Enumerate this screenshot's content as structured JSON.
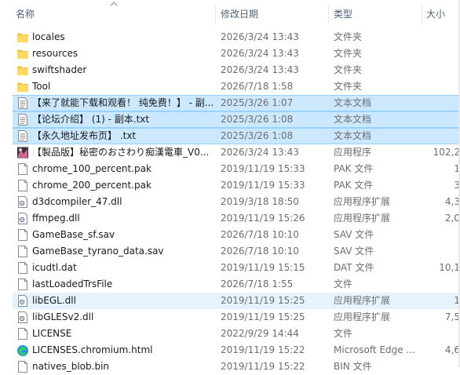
{
  "header": {
    "name": "名称",
    "date": "修改日期",
    "type": "类型",
    "size": "大小"
  },
  "files": [
    {
      "name": "locales",
      "date": "2026/3/24 13:43",
      "type": "文件夹",
      "size": "",
      "icon": "folder-icon"
    },
    {
      "name": "resources",
      "date": "2026/3/24 13:43",
      "type": "文件夹",
      "size": "",
      "icon": "folder-icon"
    },
    {
      "name": "swiftshader",
      "date": "2026/3/24 13:43",
      "type": "文件夹",
      "size": "",
      "icon": "folder-icon"
    },
    {
      "name": "Tool",
      "date": "2026/7/18 1:58",
      "type": "文件夹",
      "size": "",
      "icon": "folder-icon"
    },
    {
      "name": "【来了就能下载和观看！ 纯免费！】 - 副...",
      "date": "2025/3/26 1:07",
      "type": "文本文档",
      "size": "",
      "icon": "text-file-icon",
      "selected": true
    },
    {
      "name": "【论坛介绍】 (1) - 副本.txt",
      "date": "2025/3/26 1:08",
      "type": "文本文档",
      "size": "",
      "icon": "text-file-icon",
      "selected": true
    },
    {
      "name": "【永久地址发布页】 .txt",
      "date": "2025/3/26 1:08",
      "type": "文本文档",
      "size": "",
      "icon": "text-file-icon",
      "selected": true
    },
    {
      "name": "【製品版】秘密のおさわり痴漢電車_V0...",
      "date": "2026/3/24 13:43",
      "type": "应用程序",
      "size": "102,2",
      "icon": "app-icon"
    },
    {
      "name": "chrome_100_percent.pak",
      "date": "2019/11/19 15:33",
      "type": "PAK 文件",
      "size": "1",
      "icon": "file-icon"
    },
    {
      "name": "chrome_200_percent.pak",
      "date": "2019/11/19 15:33",
      "type": "PAK 文件",
      "size": "3",
      "icon": "file-icon"
    },
    {
      "name": "d3dcompiler_47.dll",
      "date": "2019/3/18 18:50",
      "type": "应用程序扩展",
      "size": "4,3",
      "icon": "dll-icon"
    },
    {
      "name": "ffmpeg.dll",
      "date": "2019/11/19 15:26",
      "type": "应用程序扩展",
      "size": "2,0",
      "icon": "dll-icon"
    },
    {
      "name": "GameBase_sf.sav",
      "date": "2026/7/18 10:10",
      "type": "SAV 文件",
      "size": "",
      "icon": "file-icon"
    },
    {
      "name": "GameBase_tyrano_data.sav",
      "date": "2026/7/18 10:10",
      "type": "SAV 文件",
      "size": "",
      "icon": "file-icon"
    },
    {
      "name": "icudtl.dat",
      "date": "2019/11/19 15:15",
      "type": "DAT 文件",
      "size": "10,1",
      "icon": "file-icon"
    },
    {
      "name": "lastLoadedTrsFile",
      "date": "2026/7/18 1:55",
      "type": "文件",
      "size": "",
      "icon": "file-icon"
    },
    {
      "name": "libEGL.dll",
      "date": "2019/11/19 15:25",
      "type": "应用程序扩展",
      "size": "1",
      "icon": "dll-icon",
      "hover": true
    },
    {
      "name": "libGLESv2.dll",
      "date": "2019/11/19 15:25",
      "type": "应用程序扩展",
      "size": "7,5",
      "icon": "dll-icon"
    },
    {
      "name": "LICENSE",
      "date": "2022/9/29 14:44",
      "type": "文件",
      "size": "",
      "icon": "file-icon"
    },
    {
      "name": "LICENSES.chromium.html",
      "date": "2019/11/19 15:22",
      "type": "Microsoft Edge ...",
      "size": "4,6",
      "icon": "edge-icon"
    },
    {
      "name": "natives_blob.bin",
      "date": "2019/11/19 15:22",
      "type": "BIN 文件",
      "size": "",
      "icon": "file-icon"
    }
  ]
}
